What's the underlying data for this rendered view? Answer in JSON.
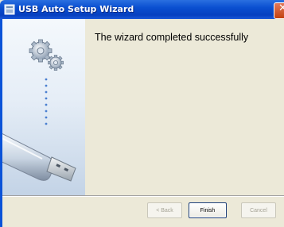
{
  "window": {
    "title": "USB Auto Setup Wizard",
    "close_symbol": "✕"
  },
  "content": {
    "heading": "The wizard completed successfully"
  },
  "buttons": {
    "back": "< Back",
    "finish": "Finish",
    "cancel": "Cancel"
  },
  "icons": {
    "title_icon": "wizard-app-icon",
    "gears": "gears-icon",
    "usb_drive": "usb-flash-drive-illustration"
  },
  "colors": {
    "titlebar": "#0a4fd0",
    "dialog_bg": "#ece9d8",
    "side_panel": "#dfe8f3",
    "close_button": "#c3400f"
  }
}
